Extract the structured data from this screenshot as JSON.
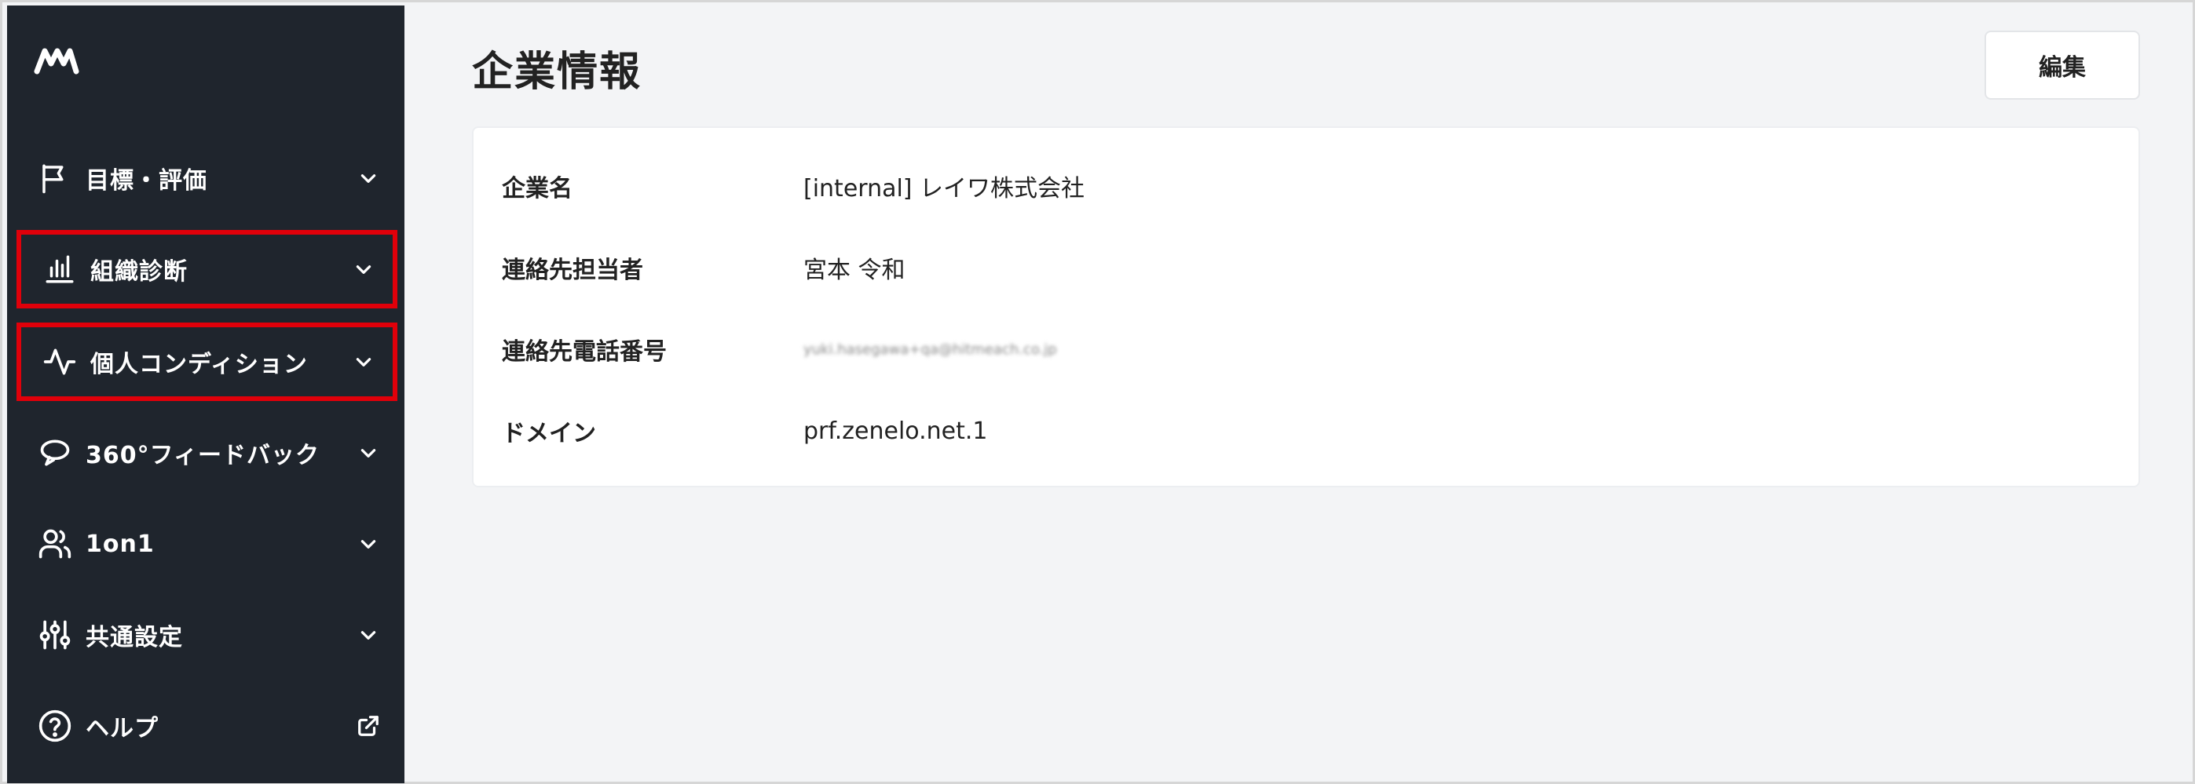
{
  "sidebar": {
    "logo_icon": "company-logo",
    "items": [
      {
        "label": "目標・評価",
        "icon": "flag-icon",
        "highlighted": false
      },
      {
        "label": "組織診断",
        "icon": "bar-chart-icon",
        "highlighted": true
      },
      {
        "label": "個人コンディション",
        "icon": "pulse-icon",
        "highlighted": true
      },
      {
        "label": "360°フィードバック",
        "icon": "feedback-loop-icon",
        "highlighted": false
      },
      {
        "label": "1on1",
        "icon": "users-icon",
        "highlighted": false
      },
      {
        "label": "共通設定",
        "icon": "sliders-icon",
        "highlighted": false
      },
      {
        "label": "ヘルプ",
        "icon": "help-circle-icon",
        "highlighted": false,
        "external": true
      }
    ]
  },
  "main": {
    "title": "企業情報",
    "edit_label": "編集",
    "fields": [
      {
        "label": "企業名",
        "value": "[internal] レイワ株式会社"
      },
      {
        "label": "連絡先担当者",
        "value": "宮本 令和"
      },
      {
        "label": "連絡先電話番号",
        "value": "yuki.hasegawa+qa@hitmeach.co.jp"
      },
      {
        "label": "ドメイン",
        "value": "prf.zenelo.net.1"
      }
    ]
  },
  "colors": {
    "sidebar_bg": "#1f252d",
    "highlight": "#e0000a",
    "page_bg": "#f3f4f6"
  }
}
